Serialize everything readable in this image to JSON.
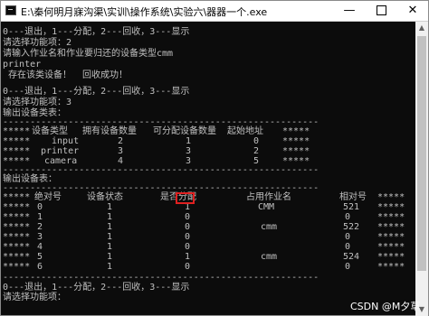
{
  "window": {
    "title": "E:\\秦何明月寐沟渠\\实训\\操作系统\\实验六\\器器一个.exe",
    "minimize_symbol": "—",
    "close_symbol": "✕"
  },
  "console": {
    "line_menu_1": "0---退出，1---分配，2---回收，3---显示",
    "line_prompt_1": "请选择功能项：2",
    "line_input_prompt": "请输入作业名和作业要归还的设备类型cmm",
    "line_printer": "printer",
    "line_result": " 存在该类设备！  回收成功！",
    "line_menu_2": "0---退出，1---分配，2---回收，3---显示",
    "line_prompt_2": "请选择功能项：3",
    "line_class_table_title": "输出设备类表：",
    "separator": "----------------------------------------------------------",
    "class_table": {
      "headers": [
        "*****",
        "设备类型",
        "拥有设备数量",
        "可分配设备数量",
        "起始地址",
        "*****"
      ],
      "rows": [
        [
          "*****",
          "input",
          "2",
          "1",
          "0",
          "*****"
        ],
        [
          "*****",
          "printer",
          "3",
          "3",
          "2",
          "*****"
        ],
        [
          "*****",
          "camera",
          "4",
          "3",
          "5",
          "*****"
        ]
      ]
    },
    "line_device_table_title": "输出设备表：",
    "device_table": {
      "headers": [
        "*****",
        "绝对号",
        "设备状态",
        "是否分配",
        "占用作业名",
        "相对号",
        "*****"
      ],
      "rows": [
        [
          "*****",
          "0",
          "1",
          "1",
          "CMM",
          "521",
          "*****"
        ],
        [
          "*****",
          "1",
          "1",
          "0",
          "",
          "0",
          "*****"
        ],
        [
          "*****",
          "2",
          "1",
          "0",
          "cmm",
          "522",
          "*****"
        ],
        [
          "*****",
          "3",
          "1",
          "0",
          "",
          "0",
          "*****"
        ],
        [
          "*****",
          "4",
          "1",
          "0",
          "",
          "0",
          "*****"
        ],
        [
          "*****",
          "5",
          "1",
          "1",
          "cmm",
          "524",
          "*****"
        ],
        [
          "*****",
          "6",
          "1",
          "0",
          "",
          "0",
          "*****"
        ]
      ]
    },
    "line_menu_3": "0---退出，1---分配，2---回收，3---显示",
    "line_prompt_3": "请选择功能项："
  },
  "watermark": "CSDN @M夕草",
  "colors": {
    "console_bg": "#0c0c0c",
    "console_text": "#c0c0c0",
    "highlight": "#e02020"
  }
}
